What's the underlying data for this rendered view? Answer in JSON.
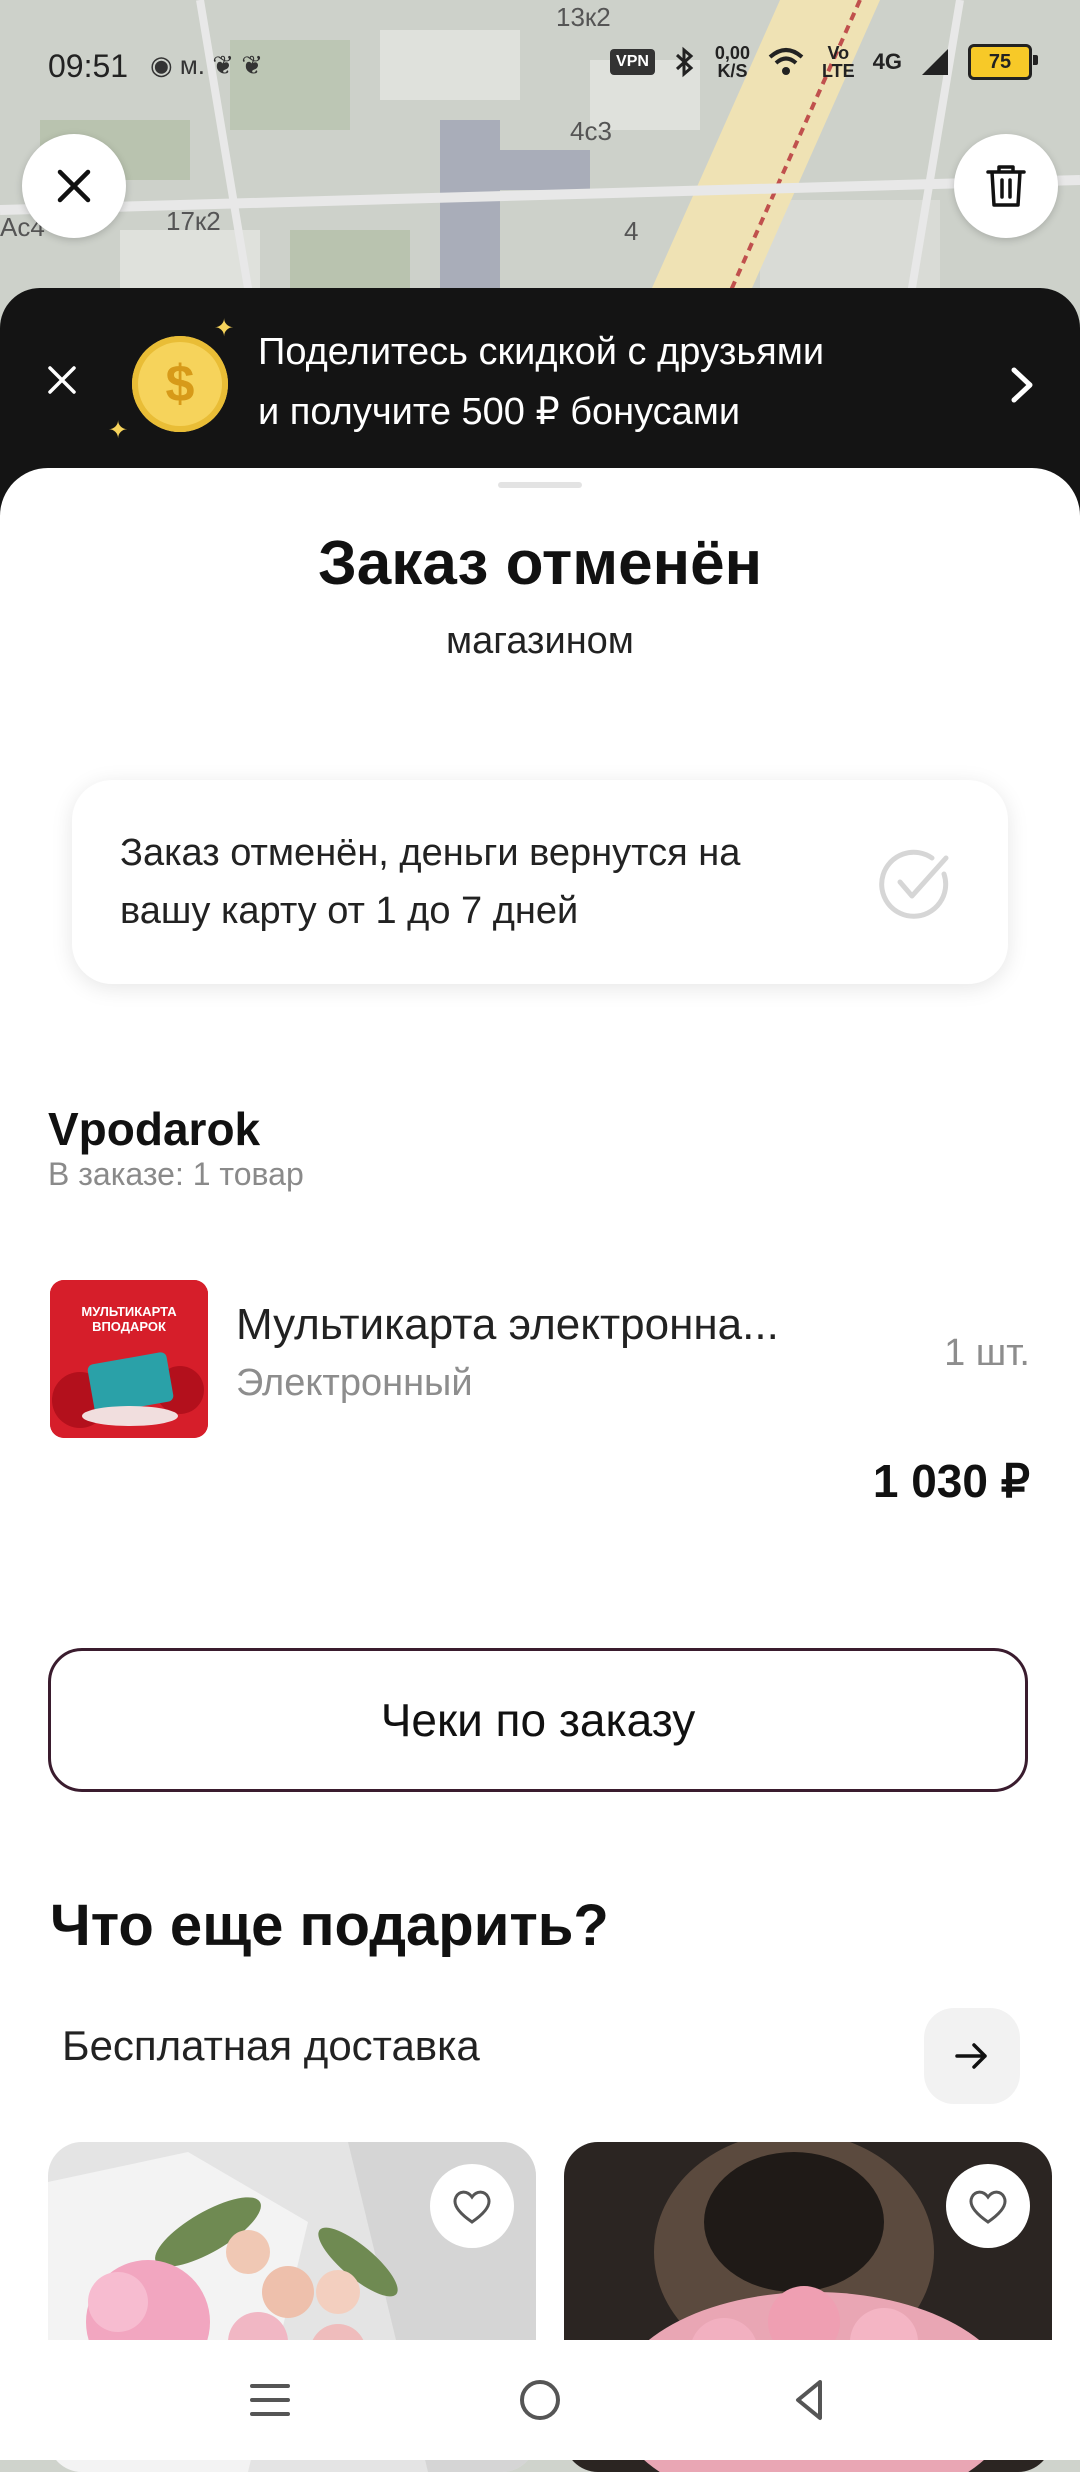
{
  "status_bar": {
    "time": "09:51",
    "notification_glyphs": "◉ м. ❦ ❦",
    "vpn": "VPN",
    "net_speed_top": "0,00",
    "net_speed_bottom": "K/S",
    "volte_top": "Vo",
    "volte_bottom": "LTE",
    "signal": "4G",
    "battery": "75"
  },
  "map": {
    "labels": [
      "13к2",
      "4с3",
      "17к2",
      "4",
      "Ас4"
    ]
  },
  "promo": {
    "line1": "Поделитесь скидкой с друзьями",
    "line2": "и получите 500 ₽ бонусами",
    "coin_symbol": "$"
  },
  "order": {
    "title": "Заказ отменён",
    "subtitle": "магазином",
    "info_line1": "Заказ отменён, деньги вернутся на",
    "info_line2": "вашу карту от 1 до 7 дней"
  },
  "seller": {
    "name": "Vpodarok",
    "items_count": "В заказе: 1 товар"
  },
  "product": {
    "name": "Мультикарта электронна...",
    "variant": "Электронный",
    "qty": "1 шт.",
    "price": "1 030 ₽",
    "image_caption_line1": "МУЛЬТИКАРТА",
    "image_caption_line2": "ВПОДАРОК"
  },
  "receipts_button": "Чеки по заказу",
  "recommendations": {
    "title": "Что еще подарить?",
    "subtitle": "Бесплатная доставка"
  },
  "colors": {
    "promo_bg": "#141414",
    "coin": "#f6d35b",
    "button_border": "#3a1c2e",
    "product_red": "#d61e2a"
  }
}
